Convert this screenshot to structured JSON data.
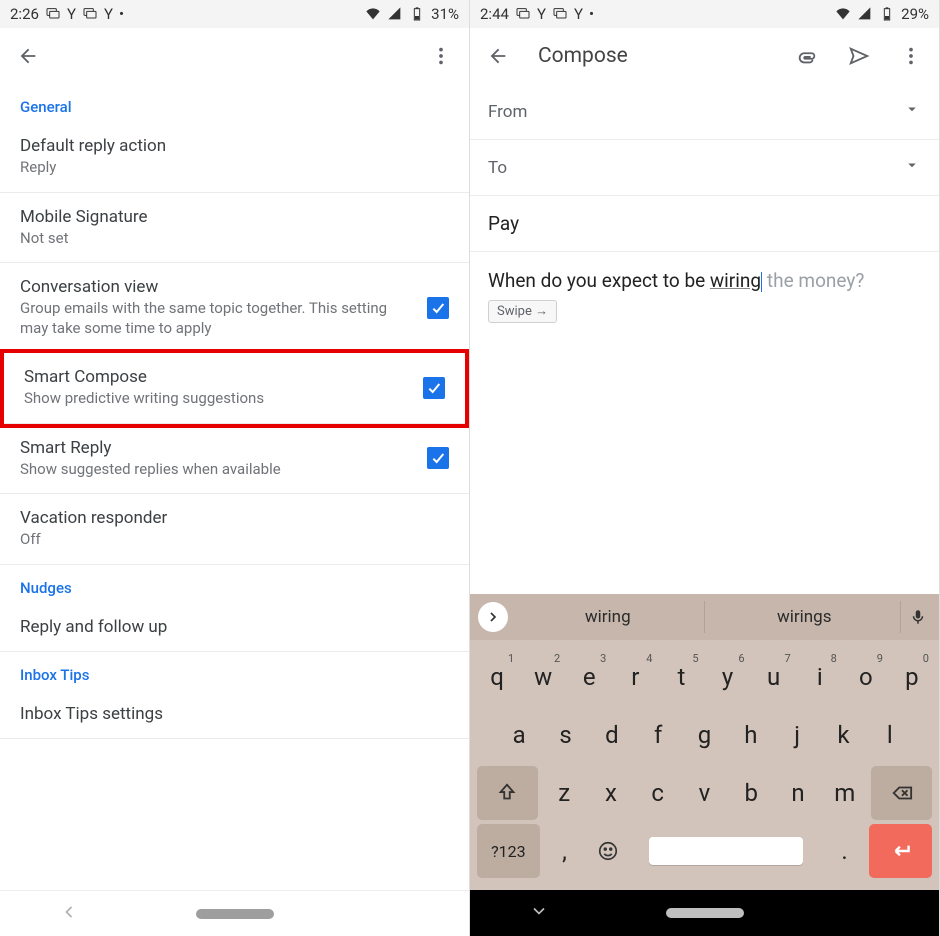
{
  "left": {
    "status": {
      "time": "2:26",
      "y1": "Y",
      "y2": "Y",
      "battery": "31%"
    },
    "sections": {
      "general": {
        "header": "General",
        "default_reply": {
          "title": "Default reply action",
          "sub": "Reply"
        },
        "mobile_sig": {
          "title": "Mobile Signature",
          "sub": "Not set"
        },
        "conversation": {
          "title": "Conversation view",
          "sub": "Group emails with the same topic together. This setting may take some time to apply",
          "checked": true
        },
        "smart_compose": {
          "title": "Smart Compose",
          "sub": "Show predictive writing suggestions",
          "checked": true
        },
        "smart_reply": {
          "title": "Smart Reply",
          "sub": "Show suggested replies when available",
          "checked": true
        },
        "vacation": {
          "title": "Vacation responder",
          "sub": "Off"
        }
      },
      "nudges": {
        "header": "Nudges",
        "item": "Reply and follow up"
      },
      "inboxtips": {
        "header": "Inbox Tips",
        "item": "Inbox Tips settings"
      }
    }
  },
  "right": {
    "status": {
      "time": "2:44",
      "y1": "Y",
      "y2": "Y",
      "battery": "29%"
    },
    "appbar_title": "Compose",
    "from_label": "From",
    "to_label": "To",
    "subject": "Pay",
    "body_prefix": "When do you expect to be ",
    "body_typed": "wiring",
    "body_suggested": " the money?",
    "swipe_label": "Swipe →",
    "suggestions": [
      "wiring",
      "wirings"
    ],
    "keys": {
      "row1": [
        [
          "q",
          "1"
        ],
        [
          "w",
          "2"
        ],
        [
          "e",
          "3"
        ],
        [
          "r",
          "4"
        ],
        [
          "t",
          "5"
        ],
        [
          "y",
          "6"
        ],
        [
          "u",
          "7"
        ],
        [
          "i",
          "8"
        ],
        [
          "o",
          "9"
        ],
        [
          "p",
          "0"
        ]
      ],
      "row2": [
        "a",
        "s",
        "d",
        "f",
        "g",
        "h",
        "j",
        "k",
        "l"
      ],
      "row3": [
        "z",
        "x",
        "c",
        "v",
        "b",
        "n",
        "m"
      ],
      "symbols": "?123",
      "comma": ",",
      "period": "."
    }
  }
}
